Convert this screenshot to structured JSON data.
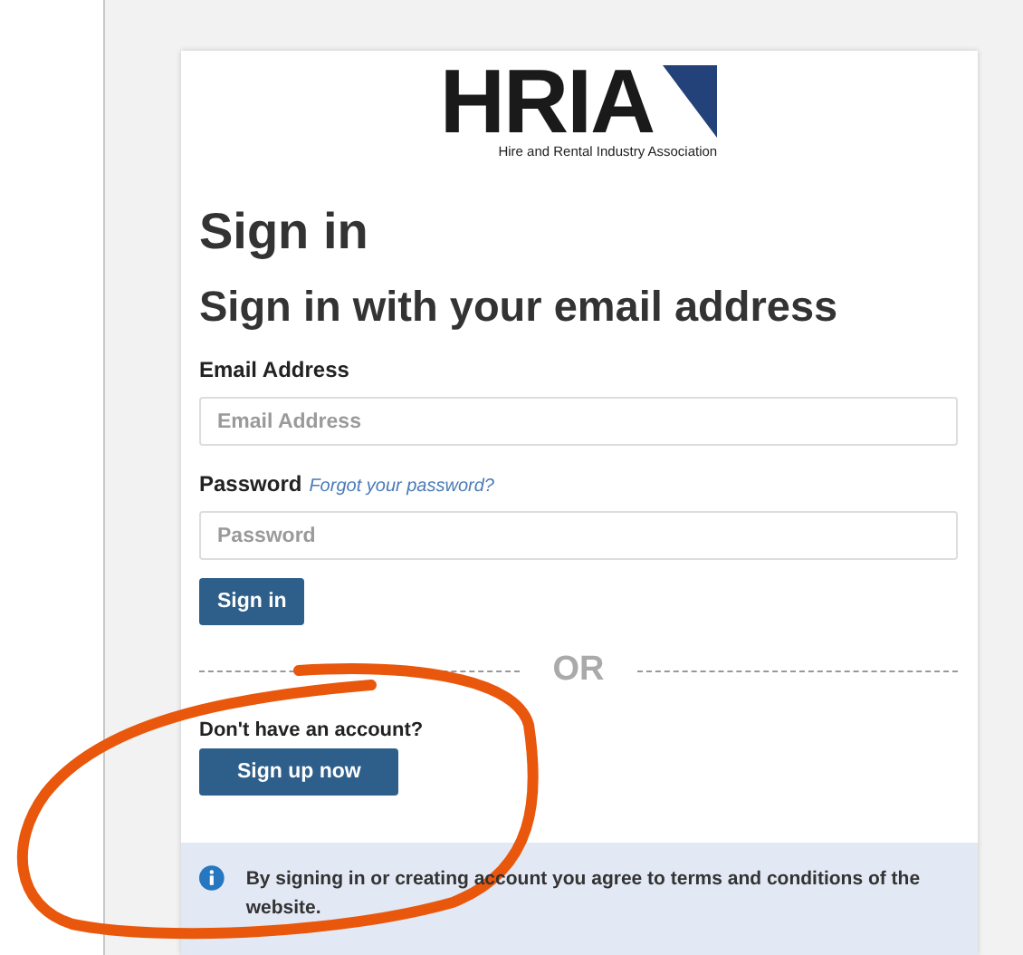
{
  "logo": {
    "mark": "HRIA",
    "tagline": "Hire and Rental Industry Association"
  },
  "title": "Sign in",
  "subtitle": "Sign in with your email address",
  "fields": [
    {
      "label": "Email Address",
      "placeholder": "Email Address"
    },
    {
      "label": "Password",
      "placeholder": "Password",
      "link": "Forgot your password?"
    }
  ],
  "sign_in_button": "Sign in",
  "divider": "OR",
  "signup_prompt": "Don't have an account?",
  "signup_button": "Sign up now",
  "notice": "By signing in or creating account you agree to terms and conditions of the website."
}
